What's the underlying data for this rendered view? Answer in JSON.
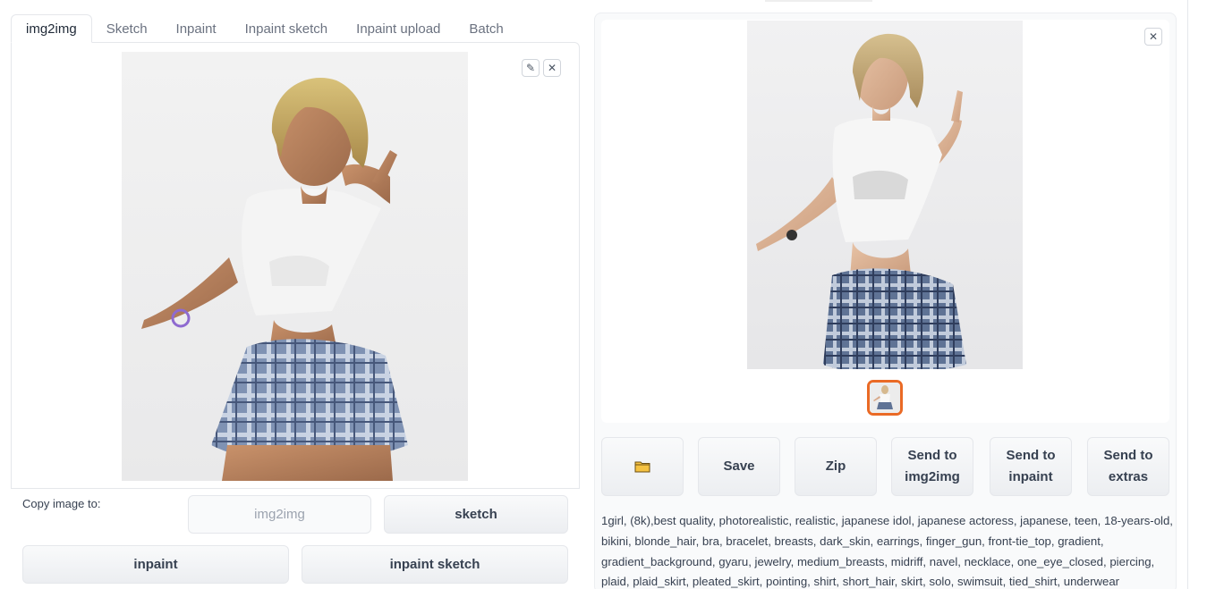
{
  "tabs": [
    "img2img",
    "Sketch",
    "Inpaint",
    "Inpaint sketch",
    "Inpaint upload",
    "Batch"
  ],
  "active_tab": "img2img",
  "input_image": {
    "alt": "uploaded source image"
  },
  "image_tools": {
    "edit_icon": "pencil-icon",
    "close_icon": "close-icon"
  },
  "copy": {
    "label": "Copy image to:",
    "img2img": "img2img",
    "sketch": "sketch",
    "inpaint": "inpaint",
    "inpaint_sketch": "inpaint sketch"
  },
  "output": {
    "close_icon": "close-icon",
    "buttons": {
      "folder_icon": "folder-icon",
      "save": "Save",
      "zip": "Zip",
      "send_img2img_1": "Send to",
      "send_img2img_2": "img2img",
      "send_inpaint_1": "Send to",
      "send_inpaint_2": "inpaint",
      "send_extras_1": "Send to",
      "send_extras_2": "extras"
    },
    "prompt": "1girl, (8k),best quality, photorealistic, realistic, japanese idol, japanese actoress, japanese, teen, 18-years-old, bikini, blonde_hair, bra, bracelet, breasts, dark_skin, earrings, finger_gun, front-tie_top, gradient, gradient_background, gyaru, jewelry, medium_breasts, midriff, navel, necklace, one_eye_closed, piercing, plaid, plaid_skirt, pleated_skirt, pointing, shirt, short_hair, skirt, solo, swimsuit, tied_shirt, underwear"
  },
  "colors": {
    "accent": "#ea6a25",
    "border": "#e5e7eb",
    "button_bg": "#f0f1f3"
  }
}
